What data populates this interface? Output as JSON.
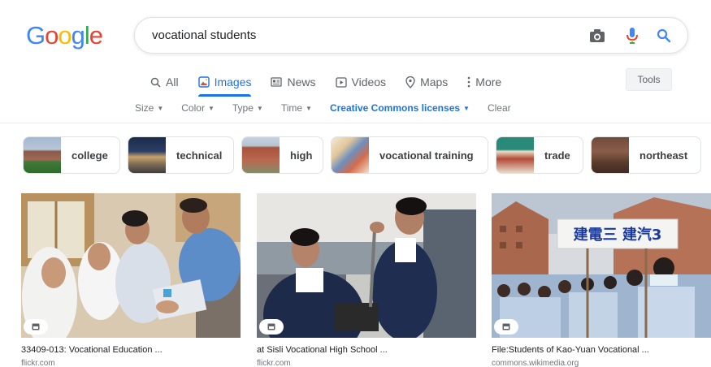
{
  "logo": {
    "letters": [
      "G",
      "o",
      "o",
      "g",
      "l",
      "e"
    ],
    "colors": [
      "#4285f4",
      "#ea4335",
      "#fbbc05",
      "#4285f4",
      "#34a853",
      "#ea4335"
    ]
  },
  "search": {
    "query": "vocational students"
  },
  "tabs": [
    {
      "label": "All",
      "icon": "search-icon"
    },
    {
      "label": "Images",
      "icon": "image-icon",
      "active": true
    },
    {
      "label": "News",
      "icon": "news-icon"
    },
    {
      "label": "Videos",
      "icon": "video-icon"
    },
    {
      "label": "Maps",
      "icon": "map-pin-icon"
    },
    {
      "label": "More",
      "icon": "more-vert-icon"
    }
  ],
  "tools_label": "Tools",
  "filters": [
    {
      "label": "Size"
    },
    {
      "label": "Color"
    },
    {
      "label": "Type"
    },
    {
      "label": "Time"
    },
    {
      "label": "Creative Commons licenses",
      "active": true
    },
    {
      "label": "Clear"
    }
  ],
  "chips": [
    {
      "label": "college"
    },
    {
      "label": "technical"
    },
    {
      "label": "high"
    },
    {
      "label": "vocational training"
    },
    {
      "label": "trade"
    },
    {
      "label": "northeast"
    }
  ],
  "results": [
    {
      "title": "33409-013: Vocational Education ...",
      "source": "flickr.com"
    },
    {
      "title": "at Sisli Vocational High School ...",
      "source": "flickr.com"
    },
    {
      "title": "File:Students of Kao-Yuan Vocational ...",
      "source": "commons.wikimedia.org"
    }
  ],
  "result_image_sign": "建電三 建汽3",
  "colors": {
    "accent": "#1a73e8",
    "mic_blue": "#4285f4",
    "mic_red": "#ea4335"
  }
}
